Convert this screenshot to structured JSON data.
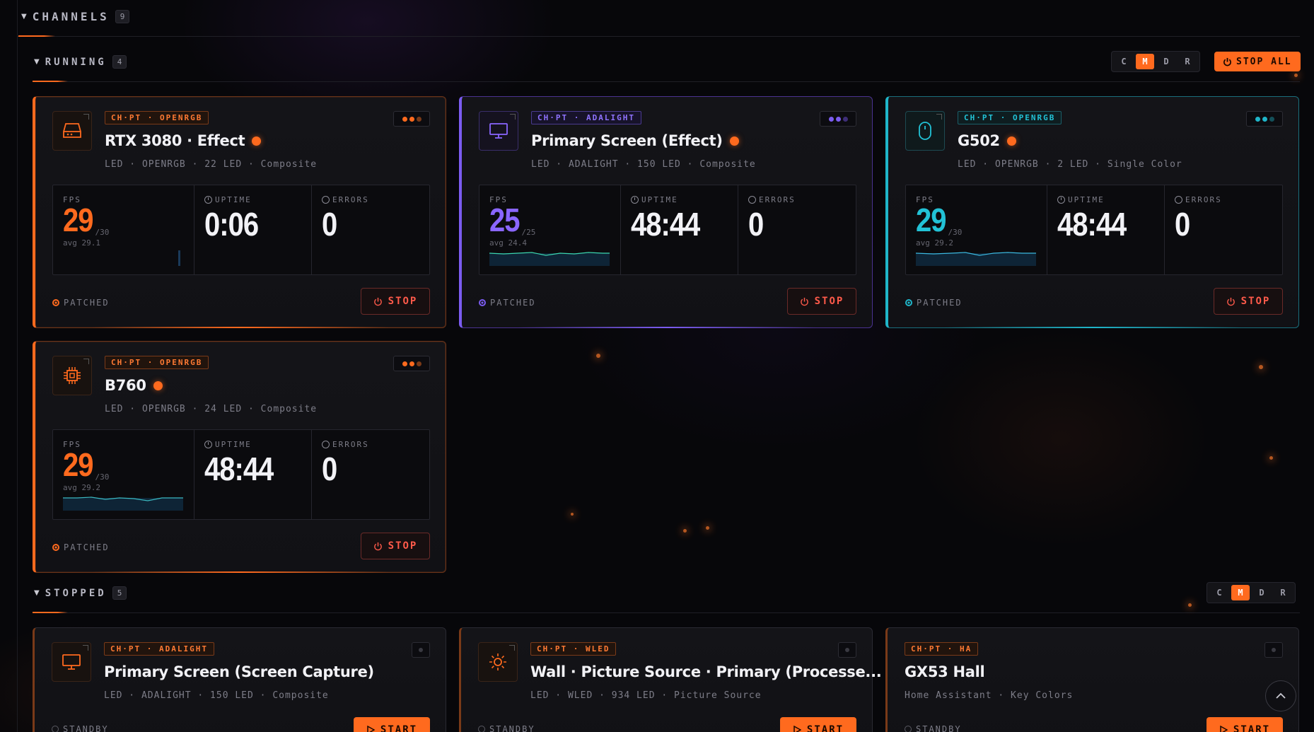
{
  "channels": {
    "title": "CHANNELS",
    "count": "9"
  },
  "running": {
    "title": "RUNNING",
    "count": "4",
    "view_modes": [
      "C",
      "M",
      "D",
      "R"
    ],
    "active_mode": "M",
    "stop_all_label": "STOP ALL"
  },
  "stopped": {
    "title": "STOPPED",
    "count": "5",
    "view_modes": [
      "C",
      "M",
      "D",
      "R"
    ],
    "active_mode": "M"
  },
  "running_cards": [
    {
      "tag": "CH·PT · OPENRGB",
      "title": "RTX 3080 · Effect",
      "subtitle": "LED · OPENRGB · 22 LED · Composite",
      "fps": "29",
      "fps_max": "/30",
      "fps_avg": "avg 29.1",
      "uptime": "0:06",
      "errors": "0",
      "patch_status": "PATCHED",
      "stop_label": "STOP",
      "accent": "#ff6a1e",
      "icon": "gpu-icon"
    },
    {
      "tag": "CH·PT · ADALIGHT",
      "title": "Primary Screen (Effect)",
      "subtitle": "LED · ADALIGHT · 150 LED · Composite",
      "fps": "25",
      "fps_max": "/25",
      "fps_avg": "avg 24.4",
      "uptime": "48:44",
      "errors": "0",
      "patch_status": "PATCHED",
      "stop_label": "STOP",
      "accent": "#7b5cf0",
      "icon": "monitor-icon"
    },
    {
      "tag": "CH·PT · OPENRGB",
      "title": "G502",
      "subtitle": "LED · OPENRGB · 2 LED · Single Color",
      "fps": "29",
      "fps_max": "/30",
      "fps_avg": "avg 29.2",
      "uptime": "48:44",
      "errors": "0",
      "patch_status": "PATCHED",
      "stop_label": "STOP",
      "accent": "#1fb5c9",
      "icon": "mouse-icon"
    },
    {
      "tag": "CH·PT · OPENRGB",
      "title": "B760",
      "subtitle": "LED · OPENRGB · 24 LED · Composite",
      "fps": "29",
      "fps_max": "/30",
      "fps_avg": "avg 29.2",
      "uptime": "48:44",
      "errors": "0",
      "patch_status": "PATCHED",
      "stop_label": "STOP",
      "accent": "#ff6a1e",
      "icon": "chip-icon"
    }
  ],
  "stat_labels": {
    "fps": "FPS",
    "uptime": "UPTIME",
    "errors": "ERRORS"
  },
  "stopped_cards": [
    {
      "tag": "CH·PT · ADALIGHT",
      "title": "Primary Screen (Screen Capture)",
      "subtitle": "LED · ADALIGHT · 150 LED · Composite",
      "status": "STANDBY",
      "start_label": "START",
      "icon": "monitor-icon"
    },
    {
      "tag": "CH·PT · WLED",
      "title": "Wall · Picture Source · Primary (Processe...",
      "subtitle": "LED · WLED · 934 LED · Picture Source",
      "status": "STANDBY",
      "start_label": "START",
      "icon": "sun-icon"
    },
    {
      "tag": "CH·PT · HA",
      "title": "GX53 Hall",
      "subtitle": "Home Assistant · Key Colors",
      "status": "STANDBY",
      "start_label": "START",
      "icon": ""
    }
  ]
}
